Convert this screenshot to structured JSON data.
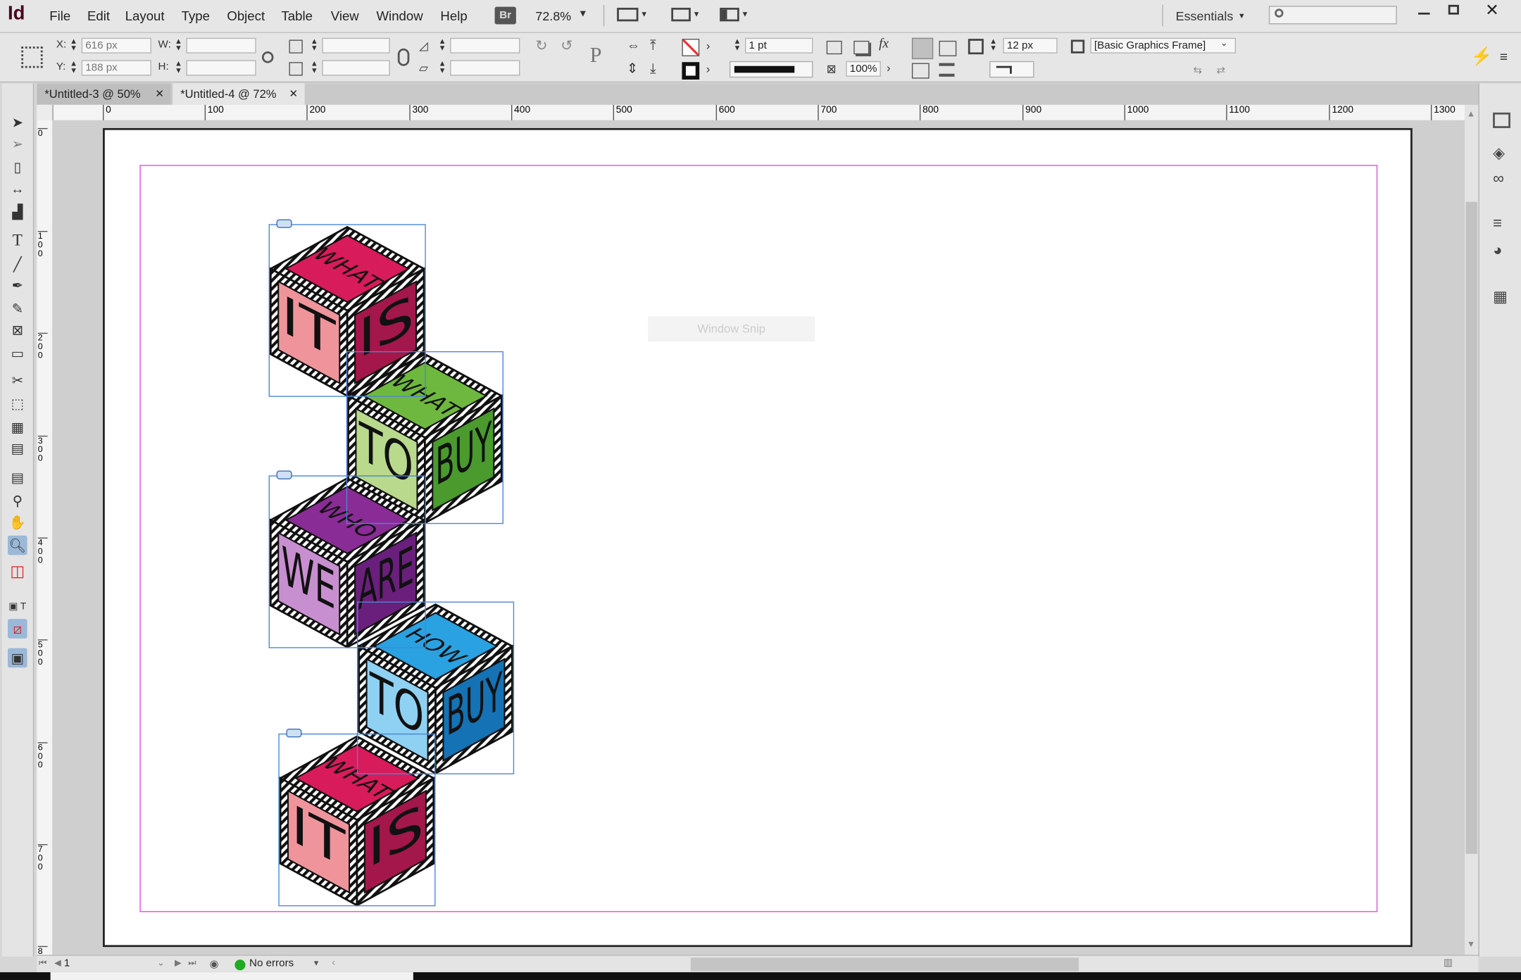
{
  "app": {
    "logo": "Id",
    "workspace": "Essentials",
    "zoom": "72.8%",
    "bridge": "Br"
  },
  "menus": [
    "File",
    "Edit",
    "Layout",
    "Type",
    "Object",
    "Table",
    "View",
    "Window",
    "Help"
  ],
  "control": {
    "x_label": "X:",
    "x_value": "616 px",
    "y_label": "Y:",
    "y_value": "188 px",
    "w_label": "W:",
    "h_label": "H:",
    "stroke_weight": "1 pt",
    "opacity": "100%",
    "gutter": "12 px",
    "object_style": "[Basic Graphics Frame]"
  },
  "tabs": [
    {
      "label": "*Untitled-3 @ 50%",
      "active": false
    },
    {
      "label": "*Untitled-4 @ 72%",
      "active": true
    }
  ],
  "ruler": {
    "top_ticks": [
      "0",
      "100",
      "200",
      "300",
      "400",
      "500",
      "600",
      "700",
      "800",
      "900",
      "1000",
      "1100",
      "1200",
      "1300"
    ],
    "left_ticks": [
      "0",
      "1 0 0",
      "2 0 0",
      "3 0 0",
      "4 0 0",
      "5 0 0",
      "6 0 0",
      "7 0 0",
      "8"
    ]
  },
  "cubes": [
    {
      "top": "WHAT",
      "left": "IT",
      "right": "IS",
      "colors": {
        "top": "#d81b5a",
        "left": "#f0949c",
        "right": "#a3174a"
      }
    },
    {
      "top": "WHAT",
      "left": "TO",
      "right": "BUY",
      "colors": {
        "top": "#6fb83f",
        "left": "#b9d98d",
        "right": "#4a9a2e"
      }
    },
    {
      "top": "WHO",
      "left": "WE",
      "right": "ARE",
      "colors": {
        "top": "#8a2c95",
        "left": "#c88fd0",
        "right": "#6a1f7c"
      }
    },
    {
      "top": "HOW",
      "left": "TO",
      "right": "BUY",
      "colors": {
        "top": "#2aa1e0",
        "left": "#8fd1f3",
        "right": "#1572b5"
      }
    },
    {
      "top": "WHAT",
      "left": "IT",
      "right": "IS",
      "colors": {
        "top": "#d81b5a",
        "left": "#f0949c",
        "right": "#a3174a"
      }
    }
  ],
  "canvas_hint": "Window Snip",
  "status": {
    "page": "1",
    "preflight": "No errors"
  },
  "colors": {
    "margin_guide": "#d94fd9",
    "frame_selection": "#4a86d6",
    "preflight_ok": "#22aa22"
  }
}
